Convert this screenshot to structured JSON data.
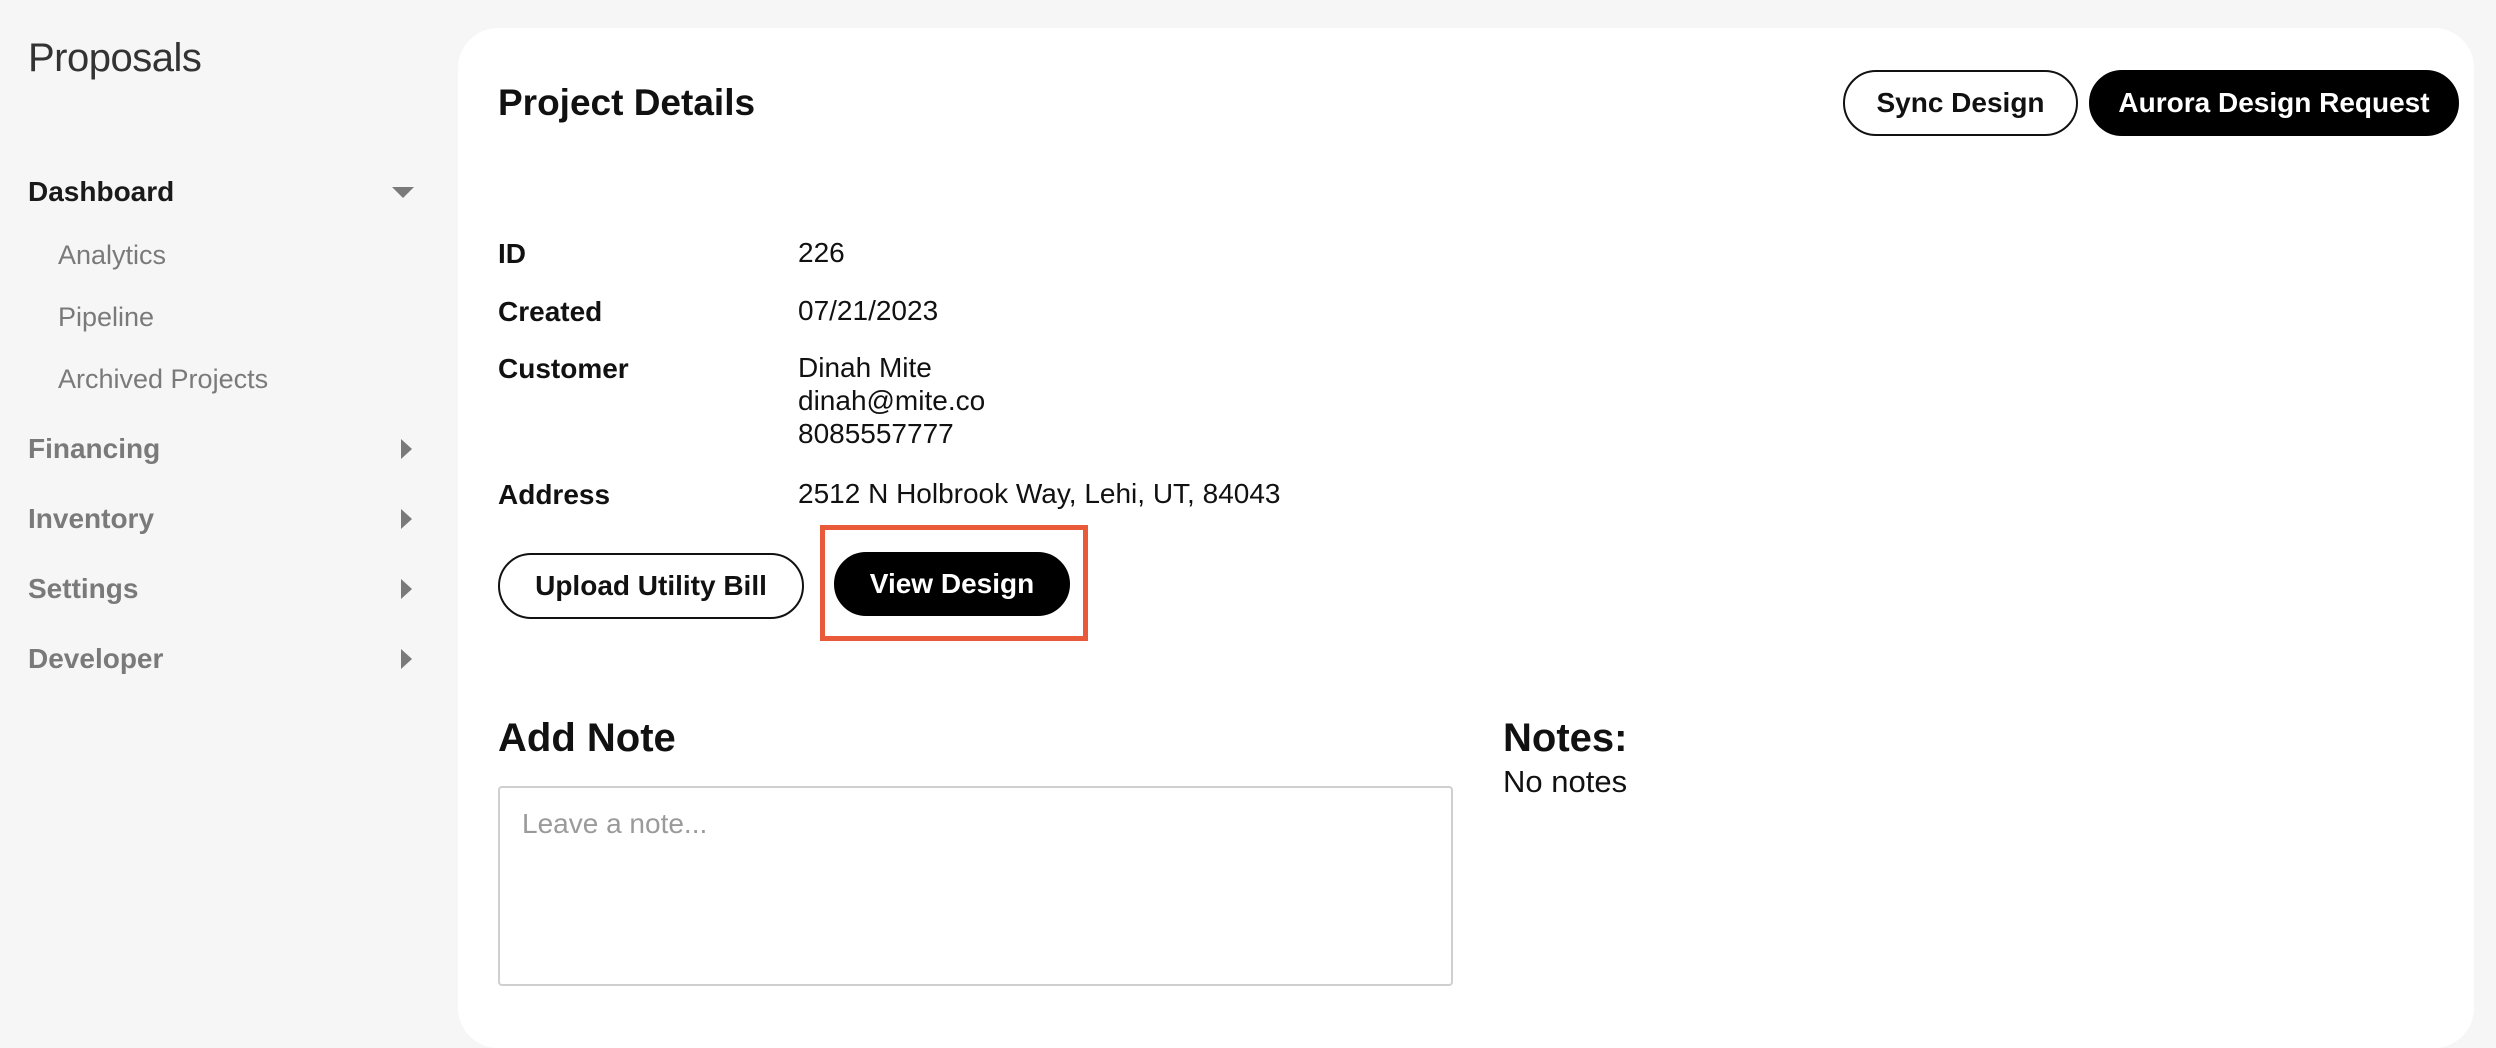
{
  "app": {
    "title": "Proposals"
  },
  "sidebar": {
    "dashboard": {
      "label": "Dashboard",
      "children": [
        "Analytics",
        "Pipeline",
        "Archived Projects"
      ]
    },
    "groups": [
      "Financing",
      "Inventory",
      "Settings",
      "Developer"
    ]
  },
  "project": {
    "title": "Project Details",
    "actions": {
      "sync_design": "Sync Design",
      "aurora_request": "Aurora Design Request",
      "upload_bill": "Upload Utility Bill",
      "view_design": "View Design"
    },
    "fields": {
      "id_label": "ID",
      "id_value": "226",
      "created_label": "Created",
      "created_value": "07/21/2023",
      "customer_label": "Customer",
      "customer_name": "Dinah Mite",
      "customer_email": "dinah@mite.co",
      "customer_phone": "8085557777",
      "address_label": "Address",
      "address_value": "2512 N Holbrook Way, Lehi, UT, 84043"
    }
  },
  "notes": {
    "add_heading": "Add Note",
    "placeholder": "Leave a note...",
    "list_heading": "Notes:",
    "empty_text": "No notes"
  },
  "colors": {
    "highlight": "#e85a3a",
    "background": "#f6f6f6",
    "card": "#ffffff"
  }
}
